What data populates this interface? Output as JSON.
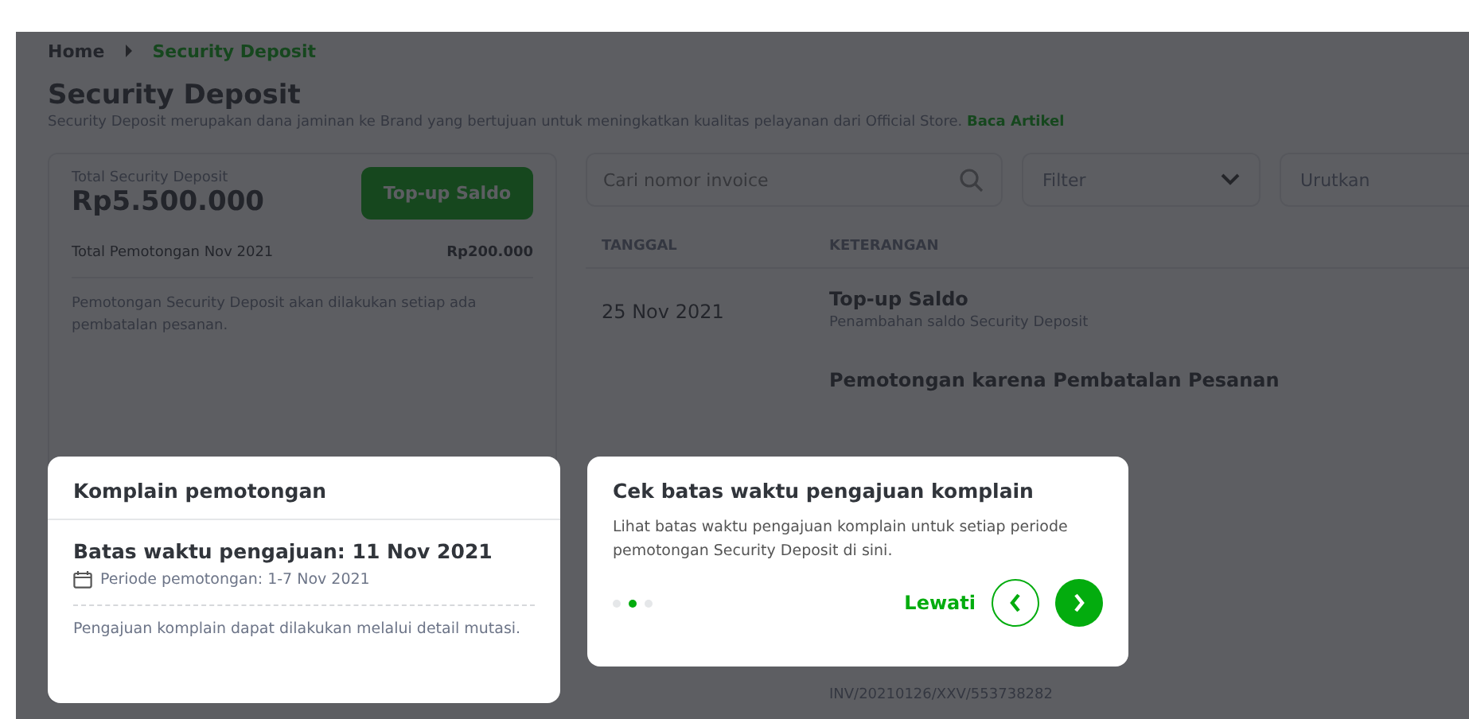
{
  "breadcrumb": [
    {
      "label": "Home",
      "current": false
    },
    {
      "label": "Security Deposit",
      "current": true
    }
  ],
  "page_title": "Security Deposit",
  "description": {
    "text": "Security Deposit merupakan dana jaminan ke Brand yang bertujuan untuk meningkatkan kualitas pelayanan dari Official Store.",
    "link": "Baca Artikel"
  },
  "summary": {
    "label": "Total Security Deposit",
    "amount": "Rp5.500.000",
    "button": "Top-up Saldo",
    "deduction_label": "Total Pemotongan Nov 2021",
    "deduction_amount": "Rp200.000",
    "note": "Pemotongan Security Deposit akan dilakukan setiap ada pembatalan pesanan."
  },
  "search": {
    "placeholder": "Cari nomor invoice"
  },
  "dropdowns": [
    {
      "label": "Filter"
    },
    {
      "label": "Urutkan"
    }
  ],
  "table": {
    "columns": [
      "TANGGAL",
      "KETERANGAN"
    ],
    "rows": [
      {
        "date": "25 Nov 2021",
        "title": "Top-up Saldo",
        "detail": "Penambahan saldo Security Deposit"
      },
      {
        "title": "Pemotongan karena Pembatalan Pesanan",
        "detail": "INV/20210126/XXV/553738282"
      }
    ]
  },
  "complaint_card": {
    "title": "Komplain pemotongan",
    "deadline": "Batas waktu pengajuan: 11 Nov 2021",
    "period": "Periode pemotongan: 1-7 Nov 2021",
    "note": "Pengajuan komplain dapat dilakukan melalui detail mutasi."
  },
  "coachmark": {
    "title": "Cek batas waktu pengajuan komplain",
    "body": "Lihat batas waktu pengajuan komplain untuk setiap periode pemotongan Security Deposit di sini.",
    "skip": "Lewati",
    "steps": [
      {
        "selected": false
      },
      {
        "selected": true
      },
      {
        "selected": false
      }
    ]
  }
}
